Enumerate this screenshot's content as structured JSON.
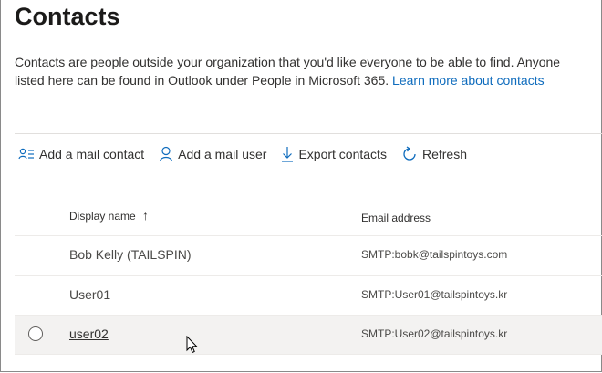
{
  "page": {
    "title": "Contacts",
    "description": "Contacts are people outside your organization that you'd like everyone to be able to find. Anyone listed here can be found in Outlook under People in Microsoft 365.",
    "learn_more": "Learn more about contacts"
  },
  "toolbar": {
    "add_mail_contact": "Add a mail contact",
    "add_mail_user": "Add a mail user",
    "export_contacts": "Export contacts",
    "refresh": "Refresh"
  },
  "table": {
    "columns": {
      "display_name": "Display name",
      "sort_indicator": "↑",
      "email_address": "Email address"
    },
    "rows": [
      {
        "display_name": "Bob Kelly (TAILSPIN)",
        "email": "SMTP:bobk@tailspintoys.com"
      },
      {
        "display_name": "User01",
        "email": "SMTP:User01@tailspintoys.kr"
      },
      {
        "display_name": "user02",
        "email": "SMTP:User02@tailspintoys.kr"
      }
    ]
  },
  "colors": {
    "link": "#0f6cbd",
    "icon_blue": "#0f6cbd",
    "selected_row": "#f3f2f1",
    "divider": "#e1dfdd"
  },
  "icons": {
    "add_mail_contact": "contact-list-icon",
    "add_mail_user": "person-icon",
    "export_contacts": "download-arrow-icon",
    "refresh": "refresh-icon",
    "cursor": "mouse-pointer-icon"
  }
}
